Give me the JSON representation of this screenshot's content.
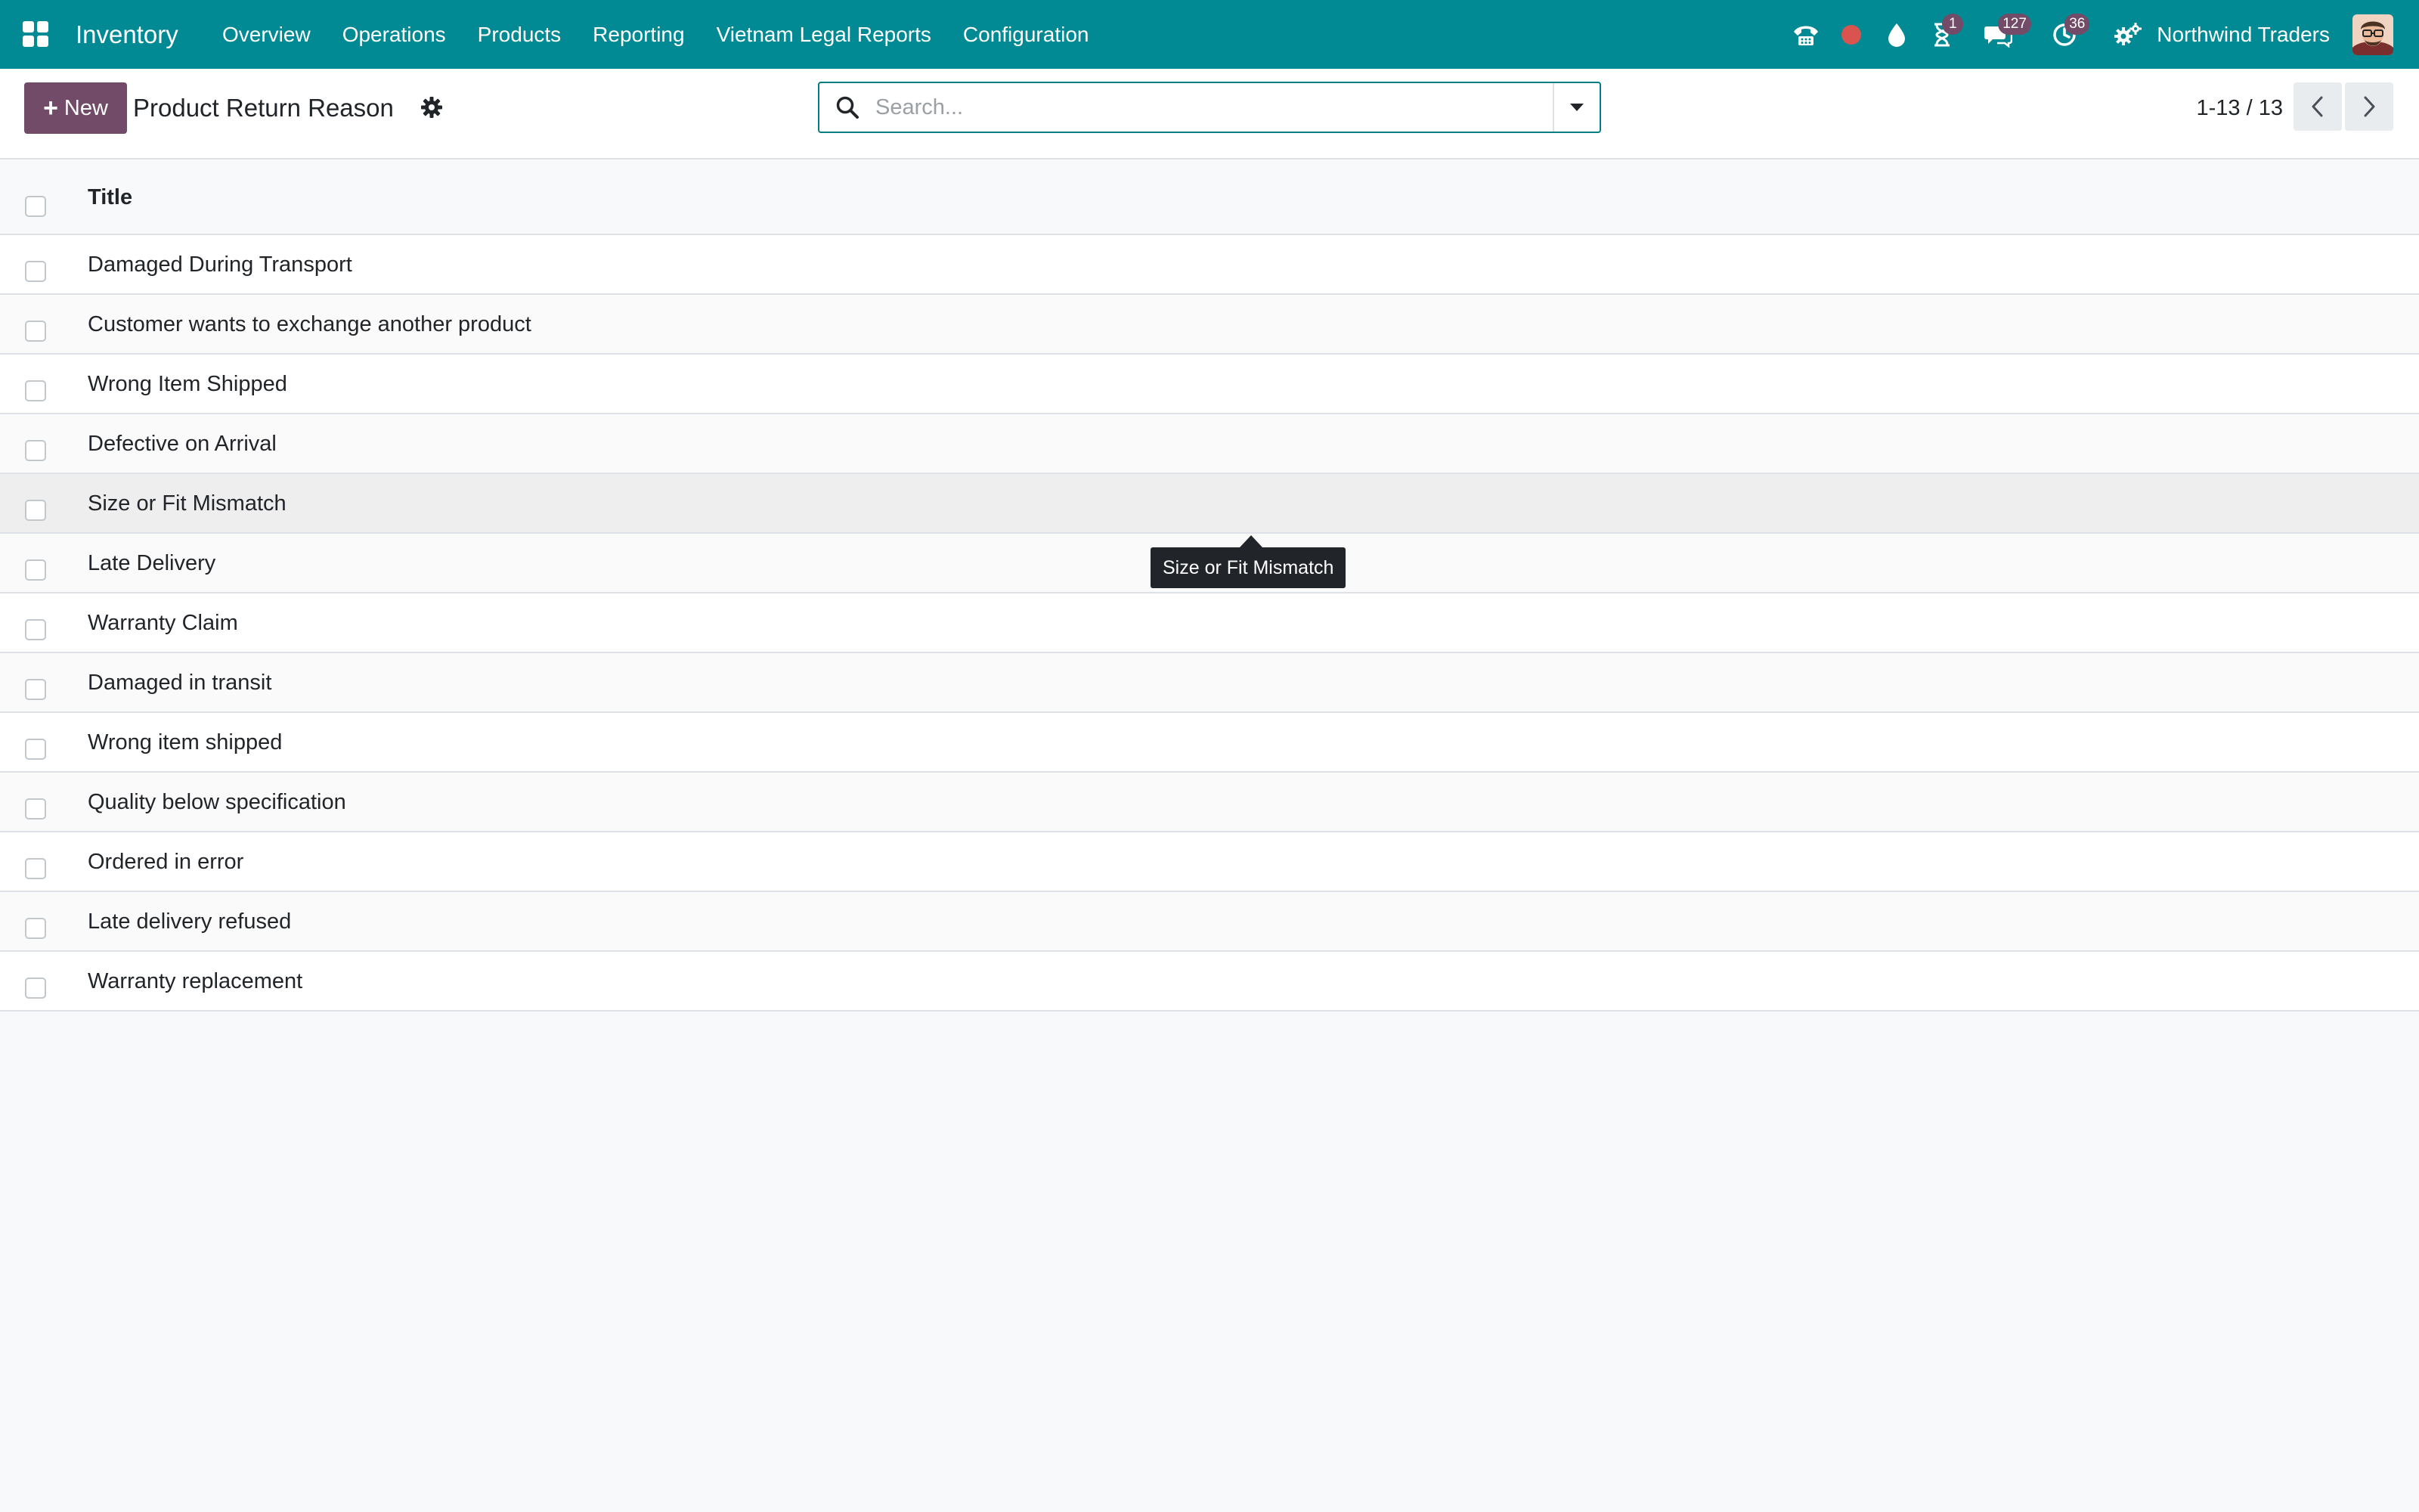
{
  "navbar": {
    "app_name": "Inventory",
    "menu": [
      {
        "label": "Overview"
      },
      {
        "label": "Operations"
      },
      {
        "label": "Products"
      },
      {
        "label": "Reporting"
      },
      {
        "label": "Vietnam Legal Reports"
      },
      {
        "label": "Configuration"
      }
    ],
    "systray": {
      "phone_icon": "phone-icon",
      "recording_icon": "record-dot-icon",
      "record_color": "#d9534f",
      "drop_icon": "water-drop-icon",
      "activities_badge": "1",
      "messages_badge": "127",
      "clock_badge": "36",
      "company_name": "Northwind Traders"
    },
    "background_color": "#018a94"
  },
  "control_panel": {
    "new_label": "New",
    "title": "Product Return Reason",
    "search_placeholder": "Search...",
    "pager_value": "1-13 / 13"
  },
  "list": {
    "columns": [
      {
        "label": "Title"
      }
    ],
    "rows": [
      {
        "title": "Damaged During Transport"
      },
      {
        "title": "Customer wants to exchange another product"
      },
      {
        "title": "Wrong Item Shipped"
      },
      {
        "title": "Defective on Arrival"
      },
      {
        "title": "Size or Fit Mismatch"
      },
      {
        "title": "Late Delivery"
      },
      {
        "title": "Warranty Claim"
      },
      {
        "title": "Damaged in transit"
      },
      {
        "title": "Wrong item shipped"
      },
      {
        "title": "Quality below specification"
      },
      {
        "title": "Ordered in error"
      },
      {
        "title": "Late delivery refused"
      },
      {
        "title": "Warranty replacement"
      }
    ]
  },
  "tooltip": {
    "text": "Size or Fit Mismatch"
  },
  "colors": {
    "primary_button": "#714b67",
    "search_border": "#017e84"
  }
}
